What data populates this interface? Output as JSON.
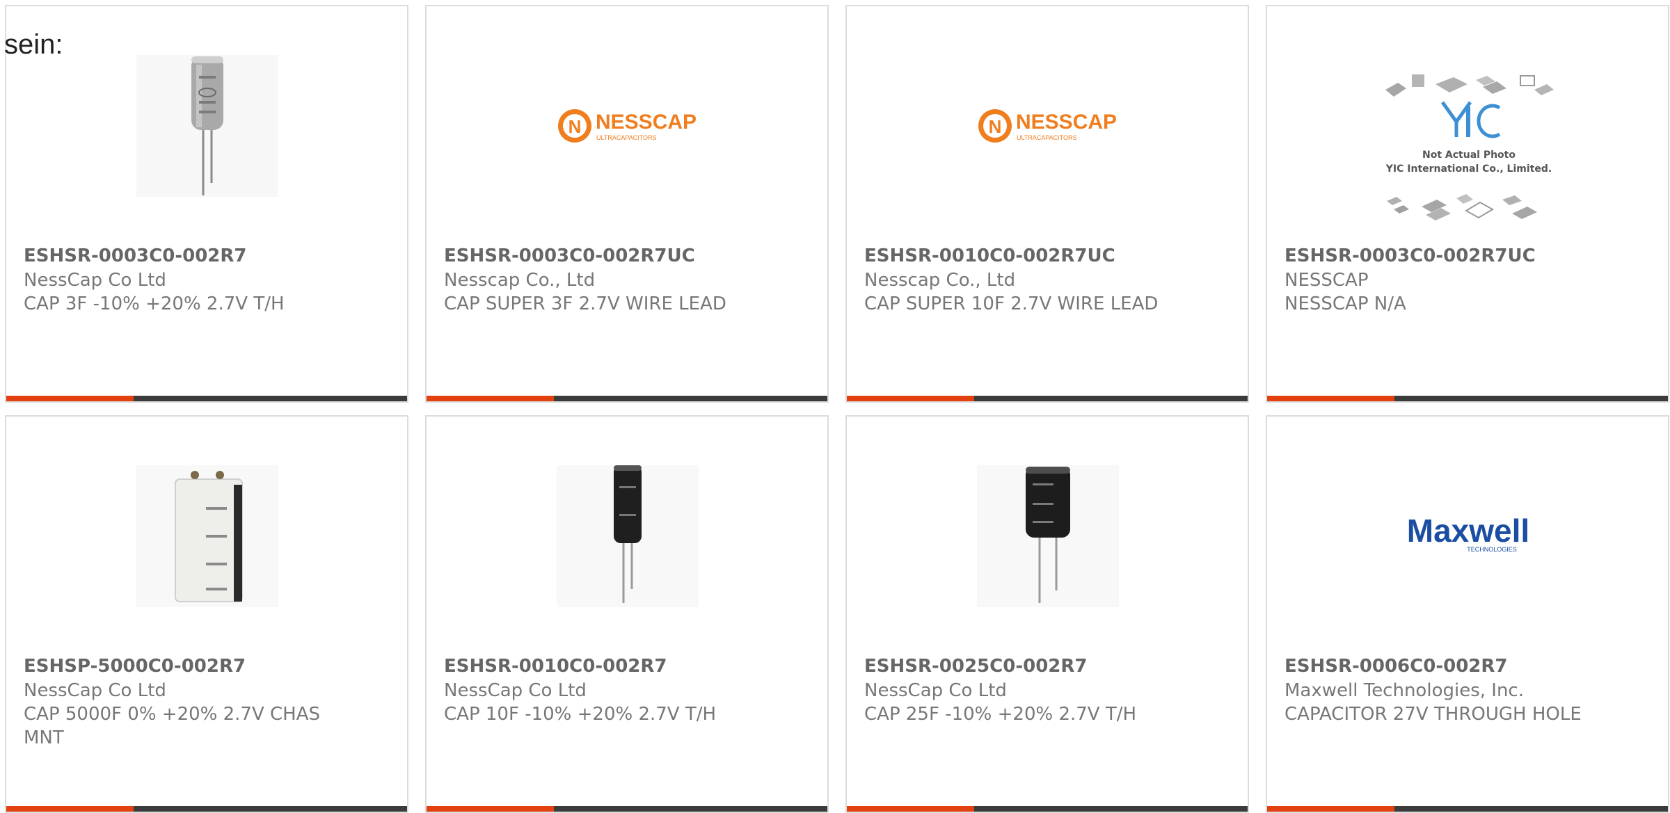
{
  "page": {
    "intro_text": "sein:"
  },
  "colors": {
    "accent": "#e2410f",
    "bar": "#3b3b3b",
    "card_border": "#dcdcdc",
    "text": "#666666"
  },
  "products": [
    {
      "part_number": "ESHSR-0003C0-002R7",
      "manufacturer": "NessCap Co Ltd",
      "description": "CAP 3F -10% +20% 2.7V T/H",
      "image": "capacitor-silver-icon"
    },
    {
      "part_number": "ESHSR-0003C0-002R7UC",
      "manufacturer": "Nesscap Co., Ltd",
      "description": "CAP SUPER 3F 2.7V WIRE LEAD",
      "image": "nesscap-logo",
      "logo_text": "NESSCAP",
      "logo_subtext": "ULTRACAPACITORS"
    },
    {
      "part_number": "ESHSR-0010C0-002R7UC",
      "manufacturer": "Nesscap Co., Ltd",
      "description": "CAP SUPER 10F 2.7V WIRE LEAD",
      "image": "nesscap-logo",
      "logo_text": "NESSCAP",
      "logo_subtext": "ULTRACAPACITORS"
    },
    {
      "part_number": "ESHSR-0003C0-002R7UC",
      "manufacturer": "NESSCAP",
      "description": "NESSCAP N/A",
      "image": "yic-placeholder",
      "logo_text": "YIC",
      "placeholder_line1": "Not Actual Photo",
      "placeholder_line2": "YIC International Co., Limited."
    },
    {
      "part_number": "ESHSP-5000C0-002R7",
      "manufacturer": "NessCap Co Ltd",
      "description": "CAP 5000F 0% +20% 2.7V CHAS MNT",
      "image": "capacitor-block-icon"
    },
    {
      "part_number": "ESHSR-0010C0-002R7",
      "manufacturer": "NessCap Co Ltd",
      "description": "CAP 10F -10% +20% 2.7V T/H",
      "image": "capacitor-black-icon"
    },
    {
      "part_number": "ESHSR-0025C0-002R7",
      "manufacturer": "NessCap Co Ltd",
      "description": "CAP 25F -10% +20% 2.7V T/H",
      "image": "capacitor-black-wide-icon"
    },
    {
      "part_number": "ESHSR-0006C0-002R7",
      "manufacturer": "Maxwell Technologies, Inc.",
      "description": "CAPACITOR 27V THROUGH HOLE",
      "image": "maxwell-logo",
      "logo_text": "Maxwell",
      "logo_subtext": "TECHNOLOGIES"
    }
  ]
}
